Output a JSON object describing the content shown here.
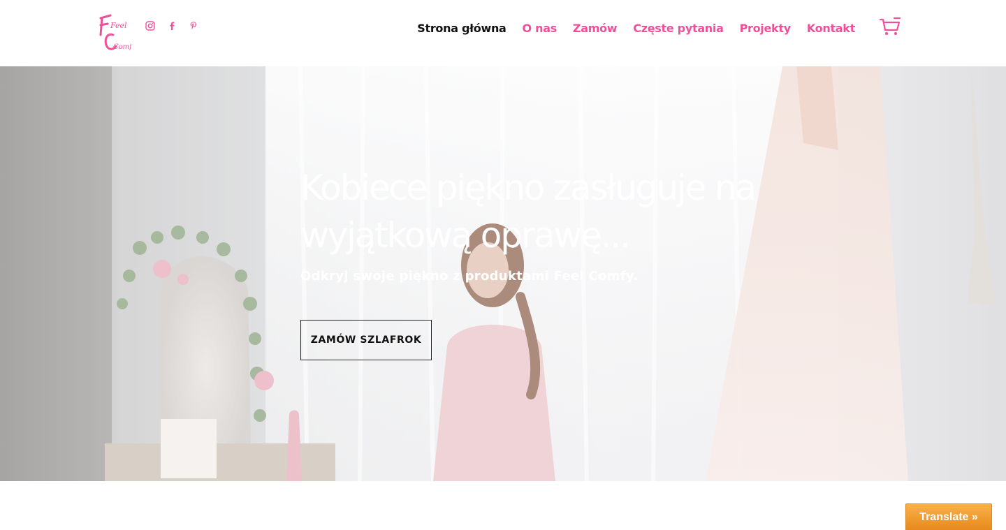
{
  "brand": {
    "logo_text_line1": "Feel",
    "logo_text_line2": "Comfy",
    "accent_color": "#f0509a"
  },
  "social": [
    {
      "icon": "instagram-icon"
    },
    {
      "icon": "facebook-icon"
    },
    {
      "icon": "pinterest-icon"
    }
  ],
  "nav": {
    "items": [
      {
        "label": "Strona główna",
        "active": true
      },
      {
        "label": "O nas",
        "active": false
      },
      {
        "label": "Zamów",
        "active": false
      },
      {
        "label": "Częste pytania",
        "active": false
      },
      {
        "label": "Projekty",
        "active": false
      },
      {
        "label": "Kontakt",
        "active": false
      }
    ],
    "cart_icon": "cart-icon"
  },
  "hero": {
    "title": "Kobiece piękno zasługuje na wyjątkową oprawę...",
    "subtitle": "Odkryj swoje piękno z produktami Feel Comfy.",
    "button_label": "ZAMÓW SZLAFROK"
  },
  "translate": {
    "label": "Translate »"
  }
}
